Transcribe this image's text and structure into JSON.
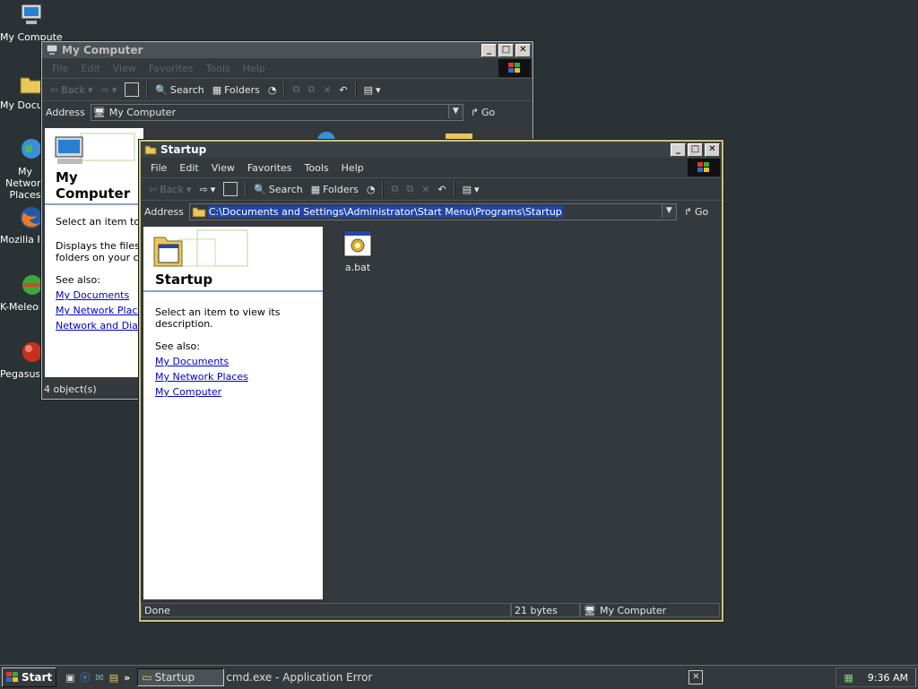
{
  "desktop": {
    "icons": [
      {
        "label": "My Computer"
      },
      {
        "label": "My Documents"
      },
      {
        "label": "My Network Places"
      },
      {
        "label": "Mozilla Firefox"
      },
      {
        "label": "K-Meleon"
      },
      {
        "label": "Pegasus"
      }
    ]
  },
  "mycomputer_window": {
    "title": "My Computer",
    "menu": [
      "File",
      "Edit",
      "View",
      "Favorites",
      "Tools",
      "Help"
    ],
    "toolbar": {
      "back": "Back",
      "search": "Search",
      "folders": "Folders"
    },
    "address_label": "Address",
    "address_value": "My Computer",
    "go_label": "Go",
    "pane_title": "My Computer",
    "pane_prompt": "Select an item to view its description.",
    "pane_desc": "Displays the files and folders on your computer",
    "see_also": "See also:",
    "links": [
      "My Documents",
      "My Network Places",
      "Network and Dial-up Connections"
    ],
    "status": "4 object(s)"
  },
  "startup_window": {
    "title": "Startup",
    "menu": [
      "File",
      "Edit",
      "View",
      "Favorites",
      "Tools",
      "Help"
    ],
    "toolbar": {
      "back": "Back",
      "search": "Search",
      "folders": "Folders"
    },
    "address_label": "Address",
    "address_value": "C:\\Documents and Settings\\Administrator\\Start Menu\\Programs\\Startup",
    "go_label": "Go",
    "pane_title": "Startup",
    "pane_prompt": "Select an item to view its description.",
    "see_also": "See also:",
    "links": [
      "My Documents",
      "My Network Places",
      "My Computer"
    ],
    "file": {
      "name": "a.bat",
      "icon": "batch-file-icon"
    },
    "status": {
      "left": "Done",
      "size": "21 bytes",
      "zone": "My Computer"
    }
  },
  "taskbar": {
    "start": "Start",
    "tasks": [
      {
        "label": "Startup",
        "active": true
      },
      {
        "label": "cmd.exe - Application Error",
        "active": false
      }
    ],
    "quick_launch_more": "»",
    "clock": "9:36 AM"
  },
  "colors": {
    "desktop": "#2b3236",
    "selection": "#2246a8",
    "link": "#0000cc",
    "active_border": "#c9c37a"
  }
}
